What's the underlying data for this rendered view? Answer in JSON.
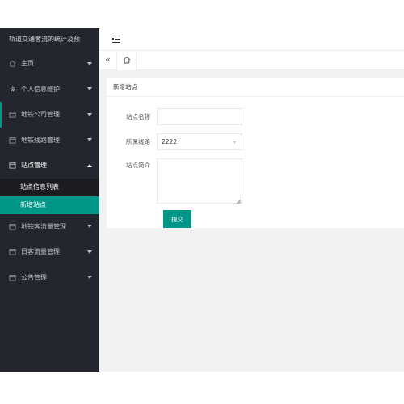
{
  "sidebar": {
    "logo_text": "轨道交通客流的统计及预",
    "items": [
      {
        "label": "主页",
        "icon": "home-icon"
      },
      {
        "label": "个人信息维护",
        "icon": "gear-icon"
      },
      {
        "label": "地铁公司管理",
        "icon": "calendar-icon"
      },
      {
        "label": "地铁线路管理",
        "icon": "calendar-icon"
      },
      {
        "label": "站点管理",
        "icon": "calendar-icon"
      },
      {
        "label": "地铁客流量管理",
        "icon": "calendar-icon"
      },
      {
        "label": "日客流量管理",
        "icon": "calendar-icon"
      },
      {
        "label": "公告管理",
        "icon": "calendar-icon"
      }
    ],
    "submenu": [
      {
        "label": "站点信息列表"
      },
      {
        "label": "新增站点"
      }
    ]
  },
  "header": {
    "toggle_icon": "menu-toggle-icon"
  },
  "tabs": {
    "prev_label": "«",
    "home_icon": "home-icon"
  },
  "form": {
    "title": "新增站点",
    "station_name_label": "站点名称",
    "station_name_value": "",
    "line_label": "所属线路",
    "line_value": "2222",
    "intro_label": "站点简介",
    "intro_value": "",
    "submit_label": "提交"
  },
  "colors": {
    "sidebar_bg": "#23262e",
    "accent": "#009688",
    "content_bg": "#f2f2f2"
  }
}
